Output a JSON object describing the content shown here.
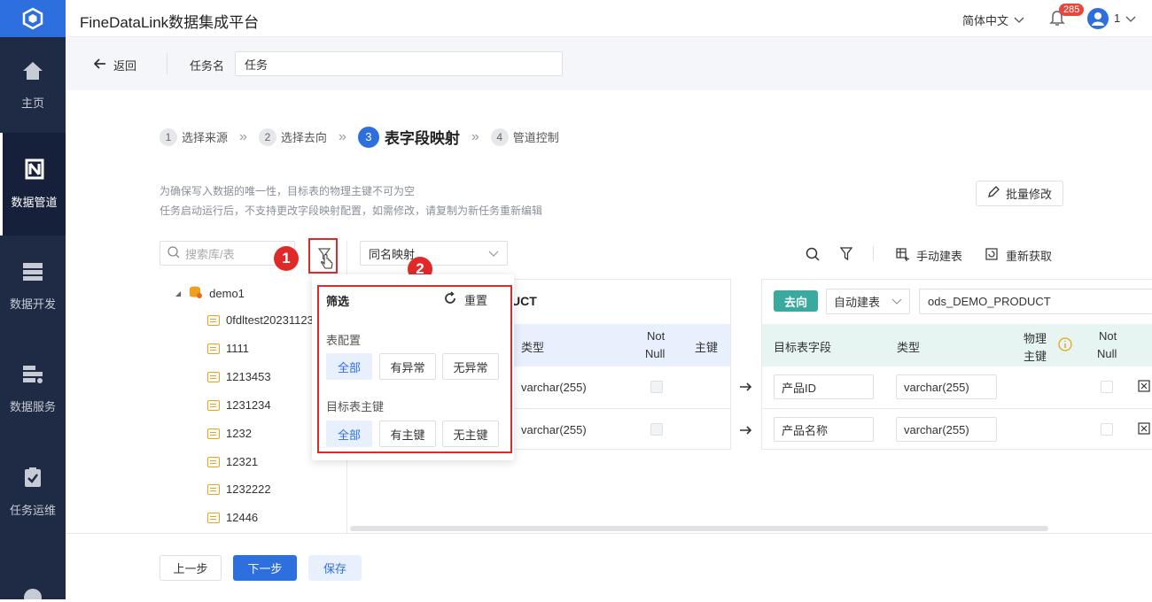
{
  "app": {
    "title": "FineDataLink数据集成平台",
    "language": "简体中文",
    "notifications": "285",
    "user": "1"
  },
  "sidebar": {
    "items": [
      {
        "label": "主页",
        "icon": "home-icon"
      },
      {
        "label": "数据管道",
        "icon": "pipeline-icon"
      },
      {
        "label": "数据开发",
        "icon": "dev-icon"
      },
      {
        "label": "数据服务",
        "icon": "service-icon"
      },
      {
        "label": "任务运维",
        "icon": "ops-icon"
      }
    ]
  },
  "header": {
    "back": "返回",
    "task_name_label": "任务名",
    "task_name_value": "任务"
  },
  "steps": [
    {
      "num": "1",
      "label": "选择来源"
    },
    {
      "num": "2",
      "label": "选择去向"
    },
    {
      "num": "3",
      "label": "表字段映射"
    },
    {
      "num": "4",
      "label": "管道控制"
    }
  ],
  "notice": {
    "line1": "为确保写入数据的唯一性，目标表的物理主键不可为空",
    "line2": "任务启动运行后，不支持更改字段映射配置，如需修改，请复制为新任务重新编辑"
  },
  "batch_edit": "批量修改",
  "search": {
    "placeholder": "搜索库/表"
  },
  "mapping_select": "同名映射",
  "toolbar": {
    "manual_create": "手动建表",
    "refetch": "重新获取"
  },
  "tree": {
    "root": "demo1",
    "tables": [
      "0fdltest20231123",
      "1111",
      "1213453",
      "1231234",
      "1232",
      "12321",
      "1232222",
      "12446"
    ]
  },
  "source_table": {
    "name_suffix": "UCT",
    "col_type": "类型",
    "col_notnull_1": "Not",
    "col_notnull_2": "Null",
    "col_pk": "主键",
    "rows": [
      {
        "type": "varchar(255)"
      },
      {
        "type": "varchar(255)"
      }
    ]
  },
  "target_table": {
    "tag": "去向",
    "create_mode": "自动建表",
    "name": "ods_DEMO_PRODUCT",
    "col_field": "目标表字段",
    "col_type": "类型",
    "col_ppk_1": "物理",
    "col_ppk_2": "主键",
    "col_notnull_1": "Not",
    "col_notnull_2": "Null",
    "rows": [
      {
        "field": "产品ID",
        "type": "varchar(255)"
      },
      {
        "field": "产品名称",
        "type": "varchar(255)"
      }
    ]
  },
  "filter_popup": {
    "title": "筛选",
    "reset": "重置",
    "group1": "表配置",
    "group1_options": [
      "全部",
      "有异常",
      "无异常"
    ],
    "group2": "目标表主键",
    "group2_options": [
      "全部",
      "有主键",
      "无主键"
    ]
  },
  "annotations": {
    "badge1": "1",
    "badge2": "2"
  },
  "footer": {
    "prev": "上一步",
    "next": "下一步",
    "save": "保存"
  },
  "colors": {
    "primary": "#2e6fe0",
    "sidebar": "#1f2a44",
    "teal": "#3aaa9e",
    "annotation_red": "#e02a2a"
  }
}
